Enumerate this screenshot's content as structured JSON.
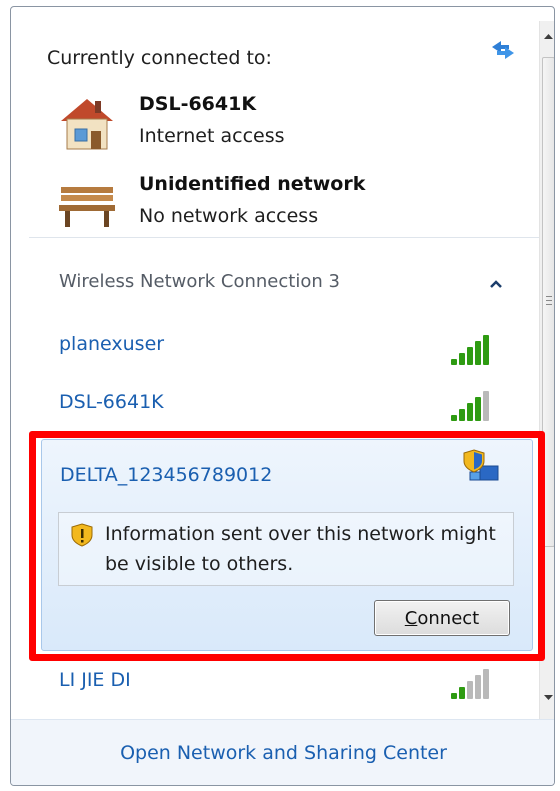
{
  "header": {
    "title": "Currently connected to:"
  },
  "connections": [
    {
      "name": "DSL-6641K",
      "status": "Internet access",
      "icon": "home-network-icon"
    },
    {
      "name": "Unidentified network",
      "status": "No network access",
      "icon": "park-bench-icon"
    }
  ],
  "section": {
    "title": "Wireless Network Connection 3"
  },
  "networks": [
    {
      "name": "planexuser",
      "signal_bars": 5
    },
    {
      "name": "DSL-6641K",
      "signal_bars": 4
    },
    {
      "name": "LI JIE DI",
      "signal_bars": 2
    }
  ],
  "selected_network": {
    "name": "DELTA_123456789012",
    "warning": "Information sent over this network might be visible to others.",
    "connect_label_accel": "C",
    "connect_label_rest": "onnect"
  },
  "footer": {
    "link": "Open Network and Sharing Center"
  },
  "colors": {
    "link": "#1a5fb0",
    "highlight": "#ff0000",
    "signal_green": "#2e9b12"
  }
}
